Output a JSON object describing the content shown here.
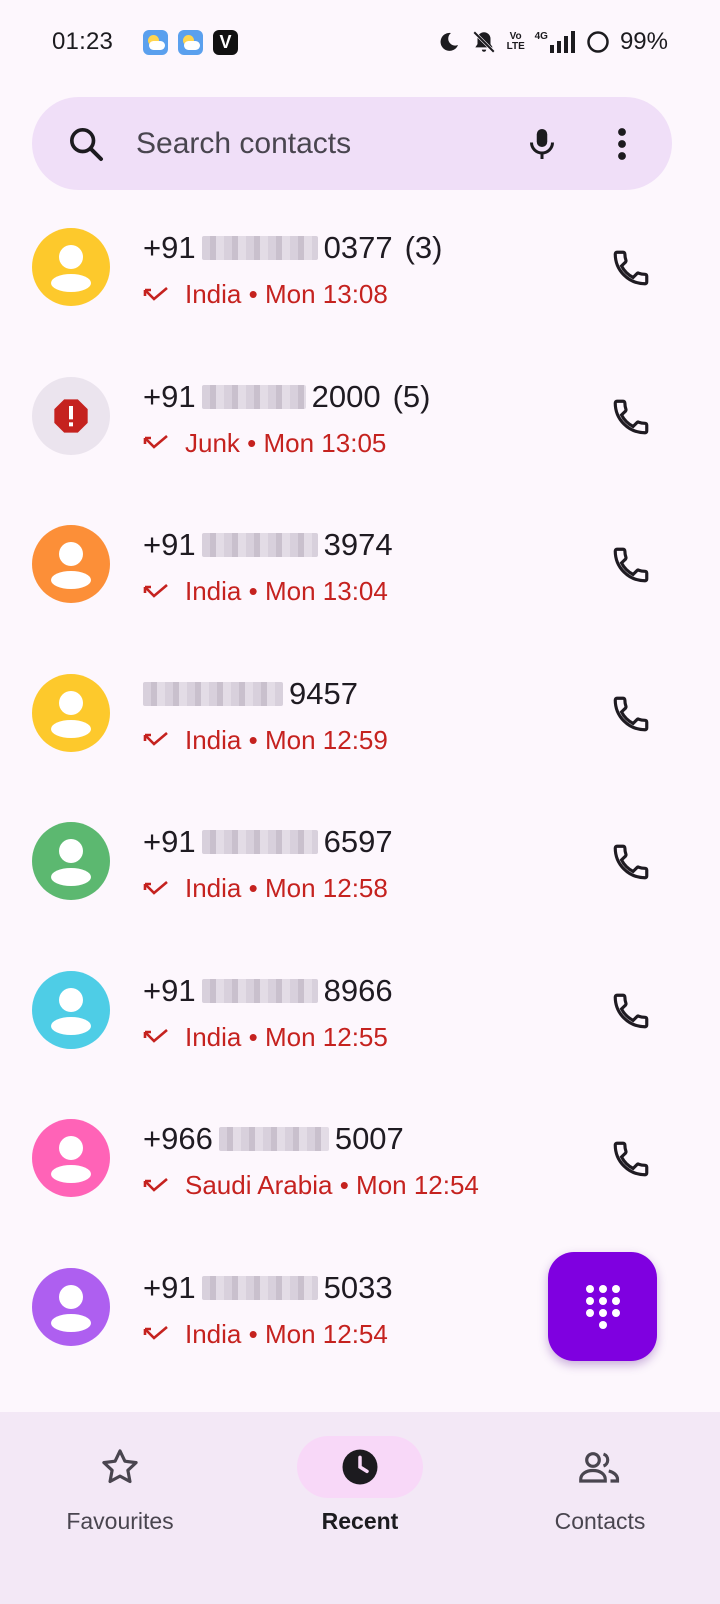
{
  "status_bar": {
    "time": "01:23",
    "battery": "99%",
    "volte_label": "Vo LTE",
    "network_label": "4G",
    "notification_icons": [
      "weather-icon",
      "weather-icon",
      "v-app-icon"
    ],
    "system_icons": [
      "moon-icon",
      "bell-off-icon",
      "volte-icon",
      "signal-icon",
      "battery-ring-icon"
    ]
  },
  "search": {
    "placeholder": "Search contacts",
    "icon": "search-icon",
    "mic_icon": "mic-icon",
    "more_icon": "more-vert-icon"
  },
  "calls": [
    {
      "prefix": "+91",
      "suffix": "0377",
      "count": "(3)",
      "location": "India",
      "time": "Mon 13:08",
      "avatar_color": "#fdc92c",
      "avatar_type": "person"
    },
    {
      "prefix": "+91",
      "suffix": "2000",
      "count": "(5)",
      "location": "Junk",
      "time": "Mon 13:05",
      "avatar_color": "#ebe4ee",
      "avatar_type": "junk"
    },
    {
      "prefix": "+91",
      "suffix": "3974",
      "count": "",
      "location": "India",
      "time": "Mon 13:04",
      "avatar_color": "#fc8f38",
      "avatar_type": "person"
    },
    {
      "prefix": "",
      "suffix": "9457",
      "count": "",
      "location": "India",
      "time": "Mon 12:59",
      "avatar_color": "#fdc92c",
      "avatar_type": "person"
    },
    {
      "prefix": "+91",
      "suffix": "6597",
      "count": "",
      "location": "India",
      "time": "Mon 12:58",
      "avatar_color": "#5cb870",
      "avatar_type": "person"
    },
    {
      "prefix": "+91",
      "suffix": "8966",
      "count": "",
      "location": "India",
      "time": "Mon 12:55",
      "avatar_color": "#4ecde6",
      "avatar_type": "person"
    },
    {
      "prefix": "+966",
      "suffix": "5007",
      "count": "",
      "location": "Saudi Arabia",
      "time": "Mon 12:54",
      "avatar_color": "#ff63b7",
      "avatar_type": "person"
    },
    {
      "prefix": "+91",
      "suffix": "5033",
      "count": "",
      "location": "India",
      "time": "Mon 12:54",
      "avatar_color": "#ae5ff0",
      "avatar_type": "person"
    }
  ],
  "separator": "•",
  "fab": {
    "icon": "dialpad-icon",
    "color": "#7f00e0"
  },
  "nav": [
    {
      "label": "Favourites",
      "icon": "star-outline-icon",
      "active": false
    },
    {
      "label": "Recent",
      "icon": "clock-icon",
      "active": true
    },
    {
      "label": "Contacts",
      "icon": "people-icon",
      "active": false
    }
  ],
  "colors": {
    "missed": "#c5221f",
    "search_bg": "#f0dff8",
    "nav_bg": "#f3e8f6",
    "active_pill": "#f8d8f8"
  }
}
